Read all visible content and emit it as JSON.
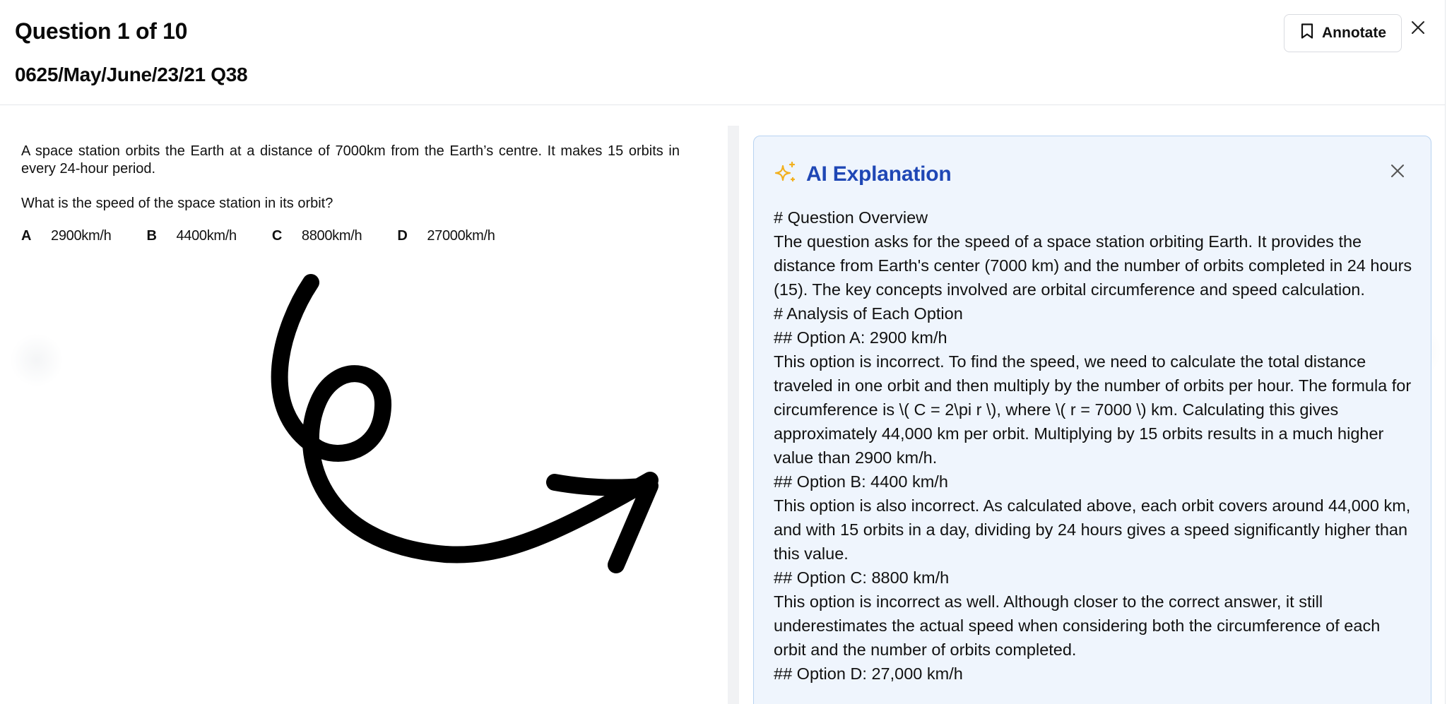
{
  "header": {
    "title": "Question 1 of 10",
    "subtitle": "0625/May/June/23/21 Q38",
    "annotate_label": "Annotate"
  },
  "question": {
    "text": "A space station orbits the Earth at a distance of 7000km from the Earth’s centre. It makes 15 orbits in every 24-hour period.",
    "ask": "What is the speed of the space station in its orbit?",
    "options": [
      {
        "letter": "A",
        "value": "2900km/h"
      },
      {
        "letter": "B",
        "value": "4400km/h"
      },
      {
        "letter": "C",
        "value": "8800km/h"
      },
      {
        "letter": "D",
        "value": "27000km/h"
      }
    ]
  },
  "ai_panel": {
    "title": "AI Explanation",
    "lines": [
      "# Question Overview",
      "The question asks for the speed of a space station orbiting Earth. It provides the distance from Earth's center (7000 km) and the number of orbits completed in 24 hours (15). The key concepts involved are orbital circumference and speed calculation.",
      "# Analysis of Each Option",
      "## Option A: 2900 km/h",
      "This option is incorrect. To find the speed, we need to calculate the total distance traveled in one orbit and then multiply by the number of orbits per hour. The formula for circumference is \\( C = 2\\pi r \\), where \\( r = 7000 \\) km. Calculating this gives approximately 44,000 km per orbit. Multiplying by 15 orbits results in a much higher value than 2900 km/h.",
      "## Option B: 4400 km/h",
      "This option is also incorrect. As calculated above, each orbit covers around 44,000 km, and with 15 orbits in a day, dividing by 24 hours gives a speed significantly higher than this value.",
      "## Option C: 8800 km/h",
      "This option is incorrect as well. Although closer to the correct answer, it still underestimates the actual speed when considering both the circumference of each orbit and the number of orbits completed.",
      "## Option D: 27,000 km/h"
    ]
  },
  "colors": {
    "ai_title": "#1f47b5",
    "ai_panel_bg": "#eff5fd",
    "ai_panel_border": "#b8d3f1",
    "sparkle": "#f2b01e"
  },
  "icons": {
    "annotate": "bookmark-icon",
    "close": "close-icon",
    "ai": "sparkles-icon"
  }
}
